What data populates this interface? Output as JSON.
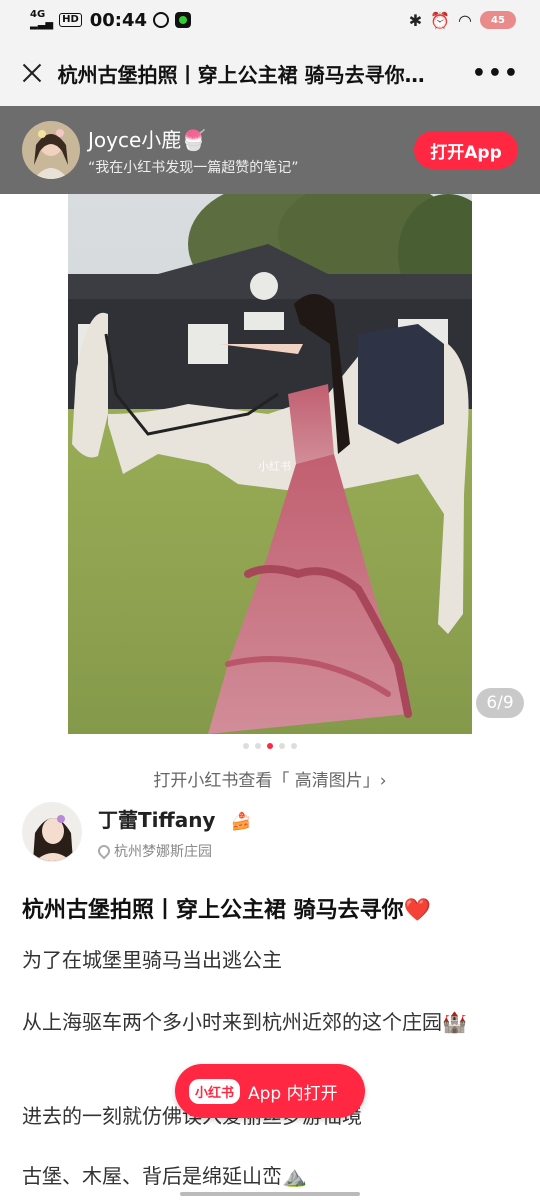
{
  "status_bar": {
    "network": "4G",
    "hd_badge": "HD",
    "time": "00:44",
    "battery": "45"
  },
  "nav": {
    "title": "杭州古堡拍照丨穿上公主裙 骑马去寻你…",
    "more": "•••"
  },
  "banner": {
    "name": "Joyce小鹿🍧",
    "subtitle": "“我在小红书发现一篇超赞的笔记”",
    "open_button": "打开App"
  },
  "photo": {
    "watermark": "小红书",
    "counter": "6/9",
    "dots_total": 5,
    "dots_active": 2
  },
  "hd_link": "打开小红书查看「 高清图片」›",
  "author": {
    "name": "丁蕾Tiffany",
    "name_emoji": "🍰",
    "location": "杭州梦娜斯庄园"
  },
  "post": {
    "title": "杭州古堡拍照丨穿上公主裙 骑马去寻你❤️",
    "paragraphs": [
      "为了在城堡里骑马当出逃公主",
      "从上海驱车两个多小时来到杭州近郊的这个庄园🏰",
      "进去的一刻就仿佛误入爱丽丝梦游仙境",
      "古堡、木屋、背后是绵延山峦⛰️"
    ]
  },
  "float_button": {
    "logo": "小红书",
    "label": "App 内打开"
  },
  "colors": {
    "brand_red": "#ff2741",
    "banner_bg": "#6d6d6d",
    "status_bg": "#f3f3f3"
  }
}
